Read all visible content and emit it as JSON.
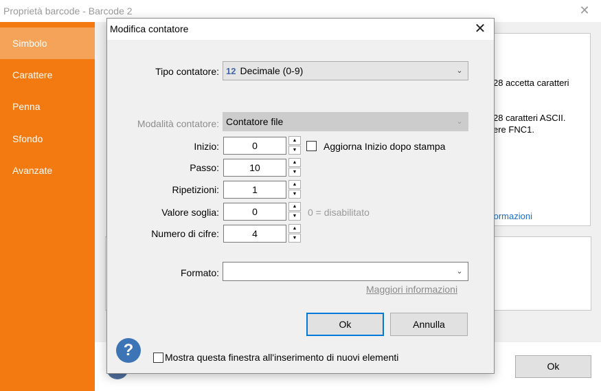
{
  "back_window": {
    "title": "Proprietà barcode - Barcode 2",
    "close_glyph": "✕",
    "sidebar": [
      {
        "label": "Simbolo",
        "active": true
      },
      {
        "label": "Carattere",
        "active": false
      },
      {
        "label": "Penna",
        "active": false
      },
      {
        "label": "Sfondo",
        "active": false
      },
      {
        "label": "Avanzate",
        "active": false
      }
    ],
    "visible_text": {
      "line1": "28 accetta caratteri",
      "line2": "28 caratteri ASCII.",
      "line3": "ere FNC1.",
      "link": "formazioni"
    },
    "ok_label": "Ok"
  },
  "dialog": {
    "title": "Modifica contatore",
    "close_glyph": "✕",
    "tipo_contatore": {
      "label": "Tipo contatore:",
      "icon_text": "12",
      "value": "Decimale (0-9)"
    },
    "modalita_contatore": {
      "label": "Modalità contatore:",
      "value": "Contatore file"
    },
    "inizio": {
      "label": "Inizio:",
      "value": "0"
    },
    "passo": {
      "label": "Passo:",
      "value": "10"
    },
    "ripetizioni": {
      "label": "Ripetizioni:",
      "value": "1"
    },
    "valore_soglia": {
      "label": "Valore soglia:",
      "value": "0",
      "hint": "0 = disabilitato"
    },
    "numero_cifre": {
      "label": "Numero di cifre:",
      "value": "4"
    },
    "aggiorna_inizio": {
      "label": "Aggiorna Inizio dopo stampa",
      "checked": false
    },
    "formato": {
      "label": "Formato:",
      "value": ""
    },
    "more_info": "Maggiori informazioni",
    "ok_label": "Ok",
    "cancel_label": "Annulla",
    "help_glyph": "?",
    "show_dialog": {
      "label": "Mostra questa finestra all'inserimento di nuovi elementi",
      "checked": false
    }
  },
  "colors": {
    "sidebar_bg": "#f37a10",
    "sidebar_active_bg": "#f6a35a",
    "link_blue": "#1a6fc2",
    "help_blue": "#3c74b6",
    "default_button_border": "#0078d7"
  }
}
